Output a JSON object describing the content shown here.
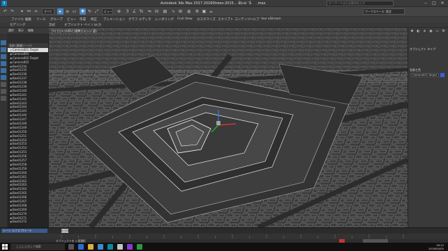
{
  "window": {
    "title": "Autodesk 3ds Max 2017    20160trees-2015... å§«è·¯å.max",
    "search_placeholder": "キーワードまたは語句を入力",
    "workspace": "ワークスペース: 既定"
  },
  "toolbar": {
    "selection_set": "すべて",
    "view_dropdown": "ビュー"
  },
  "menu": [
    "ファイル",
    "編集",
    "ツール",
    "グループ",
    "ビュー",
    "作成",
    "修正",
    "アニメーション",
    "グラフ エディタ",
    "レンダリング",
    "Civil View",
    "カスタマイズ",
    "スクリプト",
    "コンテンツ",
    "ヘルプ",
    "Vue xStream"
  ],
  "ribbon_tabs": [
    "モデリング",
    "流式",
    "オブジェクト ペイント",
    "入力"
  ],
  "scene": {
    "tabs": [
      "選択",
      "表示",
      "編集"
    ],
    "header": "名前 (昇順ソート)",
    "items": [
      "Camera001.Target",
      "Camera001",
      "Camera002.Target",
      "Camera002",
      "Box01234",
      "Box01235",
      "Box01236",
      "Box01237",
      "Box01238",
      "Box01239",
      "Box01240",
      "Box01241",
      "Box01242",
      "Box01243",
      "Box01244",
      "Box01245",
      "Box01246",
      "Box01247",
      "Box01248",
      "Box01249",
      "Box01250",
      "Box01251",
      "Box01252",
      "Box01253",
      "Box01254",
      "Box01255",
      "Box01256",
      "Box01257",
      "Box01258",
      "Box01259",
      "Box01260",
      "Box01261",
      "Box01262",
      "Box01263",
      "Box01264",
      "Box01265",
      "Box01266",
      "Box01267",
      "Box01268",
      "Box01269",
      "Box01270",
      "Box01271",
      "Box01272"
    ],
    "selected_index": 0,
    "footer_tab": "シーン エクスプローラ"
  },
  "viewport": {
    "label": "[+] [カメラ001] [標準] [エッジ 面]"
  },
  "command_panel": {
    "section1": "オブジェクト タイプ",
    "section2": "名前と色",
    "object_name": "Camera001.Target",
    "swatch_color": "#3b5fd8"
  },
  "timeline": {
    "frame": "0 / 100"
  },
  "status": {
    "text": "オブジェクトを 1 個選択"
  },
  "taskbar": {
    "search_placeholder": "ここに入力して検索",
    "time": "16:12",
    "date": "2016/04/05"
  }
}
